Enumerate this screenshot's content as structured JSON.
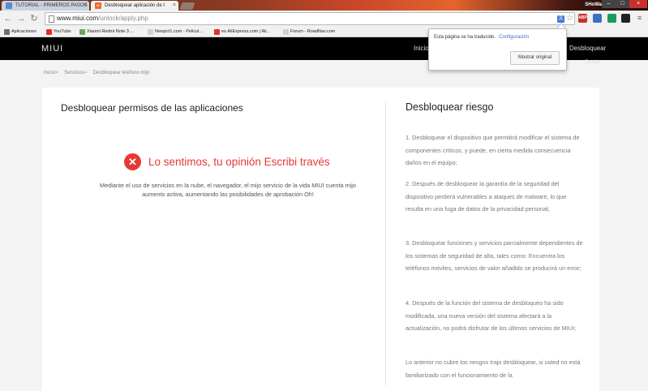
{
  "browser": {
    "tabs": [
      {
        "title": "TUTORIAL - PRIMEROS PASOS",
        "active": false
      },
      {
        "title": "Desbloquear aplicación de t",
        "active": true,
        "favicon": "MI"
      }
    ],
    "user": "SHoWa",
    "url_host": "www.miui.com",
    "url_path": "/unlock/apply.php",
    "bookmarks": [
      "Aplicaciones",
      "YouTube",
      "Xiaomi Redmi Note 3 ...",
      "Newpct1.com - Pelicul...",
      "es.AliExpress.com | Ali...",
      "Forum - RoadNav.com"
    ],
    "extension_badge": "ABP"
  },
  "translate_bubble": {
    "message": "Esta página se ha traducido.",
    "settings_link": "Configuración",
    "show_original": "Mostrar original"
  },
  "site": {
    "logo": "MIUI",
    "nav": [
      "Inicio",
      "Desbloquear"
    ],
    "nav_sub": "Desde"
  },
  "breadcrumb": [
    "Inicio>",
    "Servicios>",
    "Desbloquear teléfono mijo"
  ],
  "left": {
    "title": "Desbloquear permisos de las aplicaciones",
    "error_title": "Lo sentimos, tu opinión Escribi través",
    "error_desc": "Mediante el uso de servicios en la nube, el navegador, el mijo servicio de la vida MIUI cuenta mijo aumento activa, aumentando las posibilidades de aprobación Oh!"
  },
  "right": {
    "title": "Desbloquear riesgo",
    "paragraphs": [
      "1. Desbloquear el dispositivo que permitirá modificar el sistema de componentes críticos, y puede, en cierta medida consecuencia daños en el equipo;",
      "2. Después de desbloquear la garantía de la seguridad del dispositivo perderá vulnerables a ataques de malware, lo que resulta en una fuga de datos de la privacidad personal;",
      "3. Desbloquear funciones y servicios parcialmente dependientes de los sistemas de seguridad de alta, tales como: Encuentra los teléfonos móviles, servicios de valor añadido se producirá un error;",
      "4. Después de la función del sistema de desbloqueo ha sido modificada, una nueva versión del sistema afectará a la actualización, no podrá disfrutar de los últimos servicios de MIUI;",
      "Lo anterior no cubre los riesgos trajo desbloquear, si usted no está familiarizado con el funcionamiento de la"
    ]
  },
  "colors": {
    "error": "#e53935",
    "header": "#000000",
    "link": "#3b6fc4"
  }
}
